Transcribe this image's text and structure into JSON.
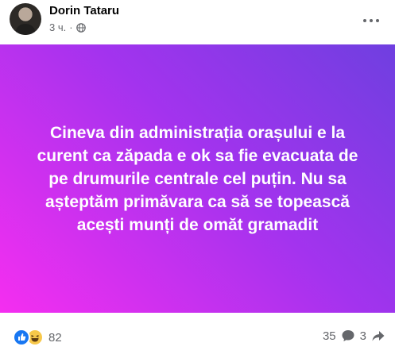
{
  "post": {
    "author": "Dorin Tataru",
    "time": "3 ч.",
    "separator": "·",
    "privacy_icon": "globe-icon",
    "text": "Cineva din administrația orașului e la curent ca zăpada e ok sa fie evacuata de pe drumurile centrale cel puțin. Nu sa așteptăm primăvara ca să se topească acești munți de omăt gramadit",
    "background_gradient": [
      "#6f3fe0",
      "#a333ee",
      "#f52ef0"
    ]
  },
  "stats": {
    "reaction_icons": [
      "like-icon",
      "haha-icon"
    ],
    "reactions_count": "82",
    "comments_count": "35",
    "shares_count": "3"
  }
}
